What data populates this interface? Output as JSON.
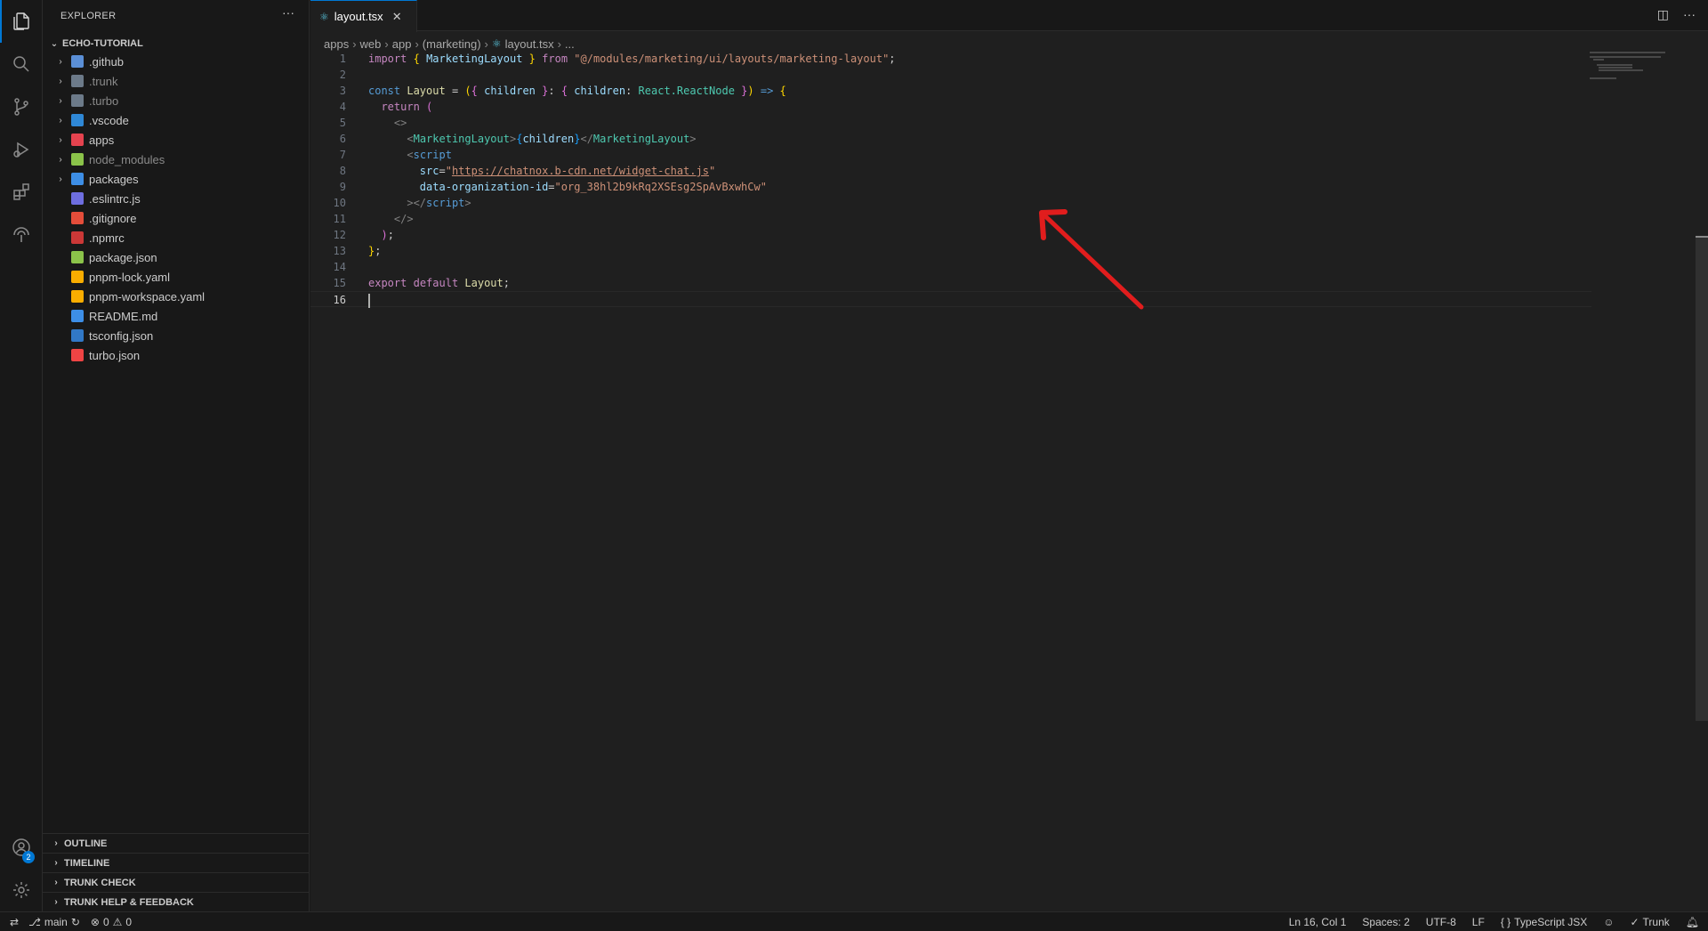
{
  "explorer": {
    "title": "EXPLORER",
    "more": "···",
    "root": "ECHO-TUTORIAL",
    "items": [
      {
        "label": ".github",
        "folder": true,
        "icon_color": "#5b8fd6",
        "dim": false
      },
      {
        "label": ".trunk",
        "folder": true,
        "icon_color": "#6c7a89",
        "dim": true
      },
      {
        "label": ".turbo",
        "folder": true,
        "icon_color": "#6c7a89",
        "dim": true
      },
      {
        "label": ".vscode",
        "folder": true,
        "icon_color": "#2f88d6",
        "dim": false
      },
      {
        "label": "apps",
        "folder": true,
        "icon_color": "#e5434f",
        "dim": false
      },
      {
        "label": "node_modules",
        "folder": true,
        "icon_color": "#8bc34a",
        "dim": true
      },
      {
        "label": "packages",
        "folder": true,
        "icon_color": "#3d8ee6",
        "dim": false
      },
      {
        "label": ".eslintrc.js",
        "folder": false,
        "icon_color": "#6e6ee0",
        "dim": false
      },
      {
        "label": ".gitignore",
        "folder": false,
        "icon_color": "#e44d3a",
        "dim": false
      },
      {
        "label": ".npmrc",
        "folder": false,
        "icon_color": "#cb3837",
        "dim": false
      },
      {
        "label": "package.json",
        "folder": false,
        "icon_color": "#8bc34a",
        "dim": false
      },
      {
        "label": "pnpm-lock.yaml",
        "folder": false,
        "icon_color": "#f9ad00",
        "dim": false
      },
      {
        "label": "pnpm-workspace.yaml",
        "folder": false,
        "icon_color": "#f9ad00",
        "dim": false
      },
      {
        "label": "README.md",
        "folder": false,
        "icon_color": "#3d8ee6",
        "dim": false
      },
      {
        "label": "tsconfig.json",
        "folder": false,
        "icon_color": "#3178c6",
        "dim": false
      },
      {
        "label": "turbo.json",
        "folder": false,
        "icon_color": "#ef4444",
        "dim": false
      }
    ],
    "panels": [
      "OUTLINE",
      "TIMELINE",
      "TRUNK CHECK",
      "TRUNK HELP & FEEDBACK"
    ]
  },
  "activity": {
    "accounts_badge": "2"
  },
  "editor": {
    "tab_label": "layout.tsx",
    "tab_close": "✕",
    "breadcrumb": [
      "apps",
      "web",
      "app",
      "(marketing)",
      "layout.tsx",
      "..."
    ],
    "line_numbers": [
      "1",
      "2",
      "3",
      "4",
      "5",
      "6",
      "7",
      "8",
      "9",
      "10",
      "11",
      "12",
      "13",
      "14",
      "15",
      "16"
    ],
    "code": {
      "import_kw": "import",
      "import_name": "MarketingLayout",
      "from_kw": "from",
      "import_path": "\"@/modules/marketing/ui/layouts/marketing-layout\"",
      "const_kw": "const",
      "layout_name": "Layout",
      "children": "children",
      "react_type": "React.ReactNode",
      "return_kw": "return",
      "component": "MarketingLayout",
      "script_tag": "script",
      "src_attr": "src",
      "src_value": "https://chatnox.b-cdn.net/widget-chat.js",
      "org_attr": "data-organization-id",
      "org_value": "\"org_38hl2b9kRq2XSEsg2SpAvBxwhCw\"",
      "export_kw": "export",
      "default_kw": "default"
    }
  },
  "statusbar": {
    "branch": "main",
    "errors": "0",
    "warnings": "0",
    "position": "Ln 16, Col 1",
    "spaces": "Spaces: 2",
    "encoding": "UTF-8",
    "eol": "LF",
    "language": "TypeScript JSX",
    "trunk": "Trunk"
  }
}
